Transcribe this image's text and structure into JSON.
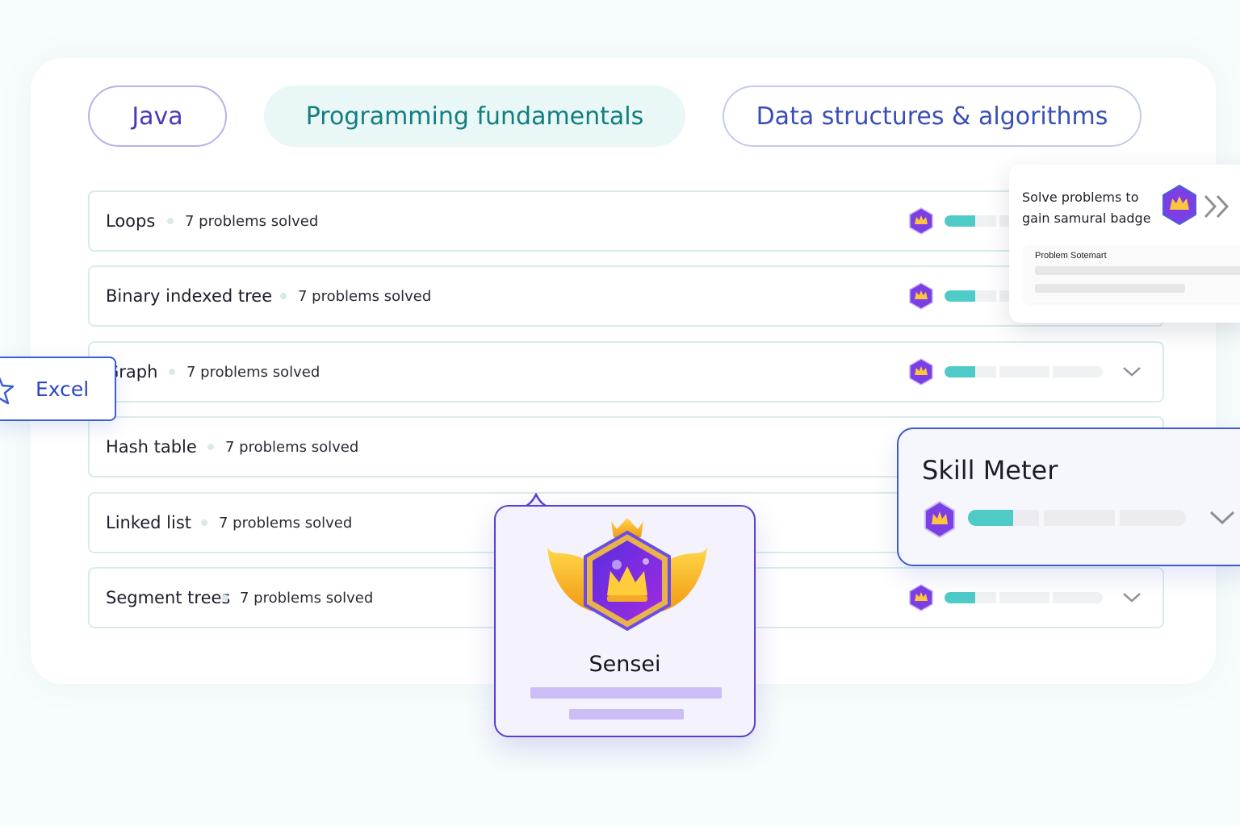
{
  "tabs": [
    {
      "label": "Java"
    },
    {
      "label": "Programming fundamentals",
      "active": true
    },
    {
      "label": "Data structures & algorithms"
    }
  ],
  "topics": [
    {
      "name": "Loops",
      "solved": "7 problems solved",
      "progress": 0.15
    },
    {
      "name": "Binary indexed tree",
      "solved": "7 problems solved",
      "progress": 0.15
    },
    {
      "name": "Graph",
      "solved": "7 problems solved",
      "progress": 0.15
    },
    {
      "name": "Hash table",
      "solved": "7 problems solved",
      "progress": 0.15
    },
    {
      "name": "Linked list",
      "solved": "7 problems solved",
      "progress": 0.15
    },
    {
      "name": "Segment trees",
      "solved": "7 problems solved",
      "progress": 0.15
    }
  ],
  "excel_chip": {
    "label": "Excel",
    "icon": "star-icon"
  },
  "hint_card": {
    "text": "Solve problems to gain samural badge",
    "inner_title": "Problem Sotemart",
    "icon": "double-chevron-right-icon"
  },
  "skill_meter": {
    "title": "Skill Meter",
    "progress": 0.2
  },
  "sensei": {
    "name": "Sensei",
    "icon": "crown-badge-icon"
  },
  "colors": {
    "accent_teal": "#4ecbc6",
    "badge_purple": "#7b3fe4",
    "primary_blue": "#3d5ad4",
    "active_tab_bg": "#e9f7f7"
  }
}
